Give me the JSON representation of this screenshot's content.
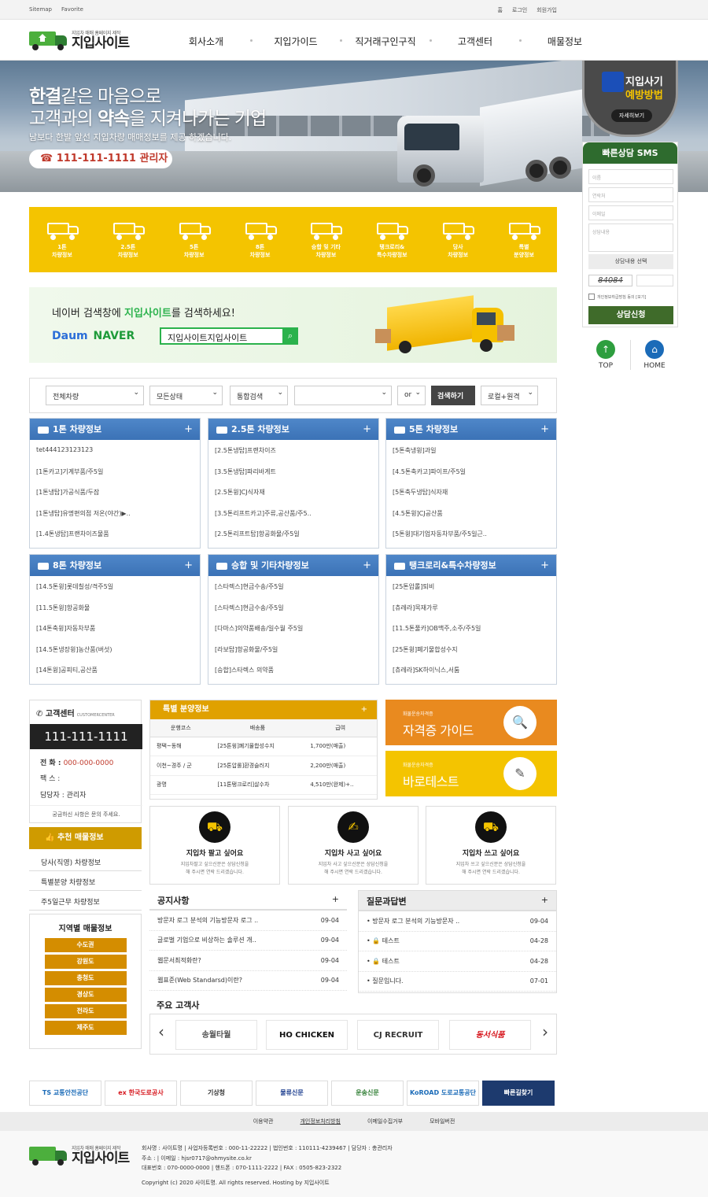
{
  "topbar": {
    "left": [
      "Sitemap",
      "Favorite"
    ],
    "right": [
      "홈",
      "로그인",
      "회원가입"
    ]
  },
  "logo": {
    "small": "지입차 매매 홈페이지 제작",
    "big": "지입사이트"
  },
  "nav": [
    "회사소개",
    "지입가이드",
    "직거래구인구직",
    "고객센터",
    "매물정보"
  ],
  "hero": {
    "line1_bold": "한결",
    "line1": "같은 마음으로",
    "line2a": "고객과의 ",
    "line2_bold": "약속",
    "line2b": "을 지켜나가는 기업",
    "sub": "남보다 한발 앞선 지입차량 매매정보를 제공 하겠습니다.",
    "phone": "☎ 111-111-1111 관리자"
  },
  "badge": {
    "t1": "지입사기",
    "t2": "예방방법",
    "btn": "자세히보기"
  },
  "sms": {
    "title": "빠른상담 SMS",
    "name": "이름",
    "phone": "연락처",
    "email": "이메일",
    "content": "상담내용",
    "select": "상담내용 선택",
    "captcha": "84084",
    "agree": "개인정보취급방침 동의 [보기]",
    "submit": "상담신청"
  },
  "quick": {
    "top": "TOP",
    "home": "HOME"
  },
  "categories": [
    {
      "l1": "1톤",
      "l2": "차량정보"
    },
    {
      "l1": "2.5톤",
      "l2": "차량정보"
    },
    {
      "l1": "5톤",
      "l2": "차량정보"
    },
    {
      "l1": "8톤",
      "l2": "차량정보"
    },
    {
      "l1": "승합 및 기타",
      "l2": "차량정보"
    },
    {
      "l1": "탱크로리&",
      "l2": "특수차량정보"
    },
    {
      "l1": "당사",
      "l2": "차량정보"
    },
    {
      "l1": "특별",
      "l2": "분양정보"
    }
  ],
  "naver": {
    "pre": "네이버 검색창에 ",
    "bold": "지입사이트",
    "post": "를 검색하세요!",
    "logo1": "Daum",
    "logo2": "NAVER",
    "query": "지입사이트지입사이트"
  },
  "search": {
    "s1": "전체차량",
    "s2": "모든상태",
    "s3": "통합검색",
    "s4": "or",
    "btn": "검색하기",
    "s5": "로컬+원격"
  },
  "panels": [
    {
      "title": "1톤 차량정보",
      "items": [
        "tet444123123123",
        "[1톤카고]기계부품/주5일",
        "[1톤냉탑]가공식품/두잠",
        "[1톤냉탑]유명편의점 저온(야간)▶..",
        "[1.4톤냉탑]프랜차이즈물품"
      ]
    },
    {
      "title": "2.5톤 차량정보",
      "items": [
        "[2.5톤냉탑]프랜차이즈",
        "[3.5톤냉탑]파리바게트",
        "[2.5톤윙]CJ식자재",
        "[3.5톤리프트카고]주류,공산품/주5..",
        "[2.5톤리프트탑]항공화물/주5일"
      ]
    },
    {
      "title": "5톤 차량정보",
      "items": [
        "[5톤축냉윙]과일",
        "[4.5톤축카고]파이프/주5일",
        "[5톤축두냉탑]식자재",
        "[4.5톤윙]CJ공산품",
        "[5톤윙]대기업자동차부품/주5일근.."
      ]
    },
    {
      "title": "8톤 차량정보",
      "items": [
        "[14.5톤윙]롯데칠성/격주5일",
        "[11.5톤윙]항공화물",
        "[14톤축윙]자동차부품",
        "[14.5톤냉장윙]농산품(버섯)",
        "[14톤윙]공피티,공산품"
      ]
    },
    {
      "title": "승합 및 기타차량정보",
      "items": [
        "[스타렉스]현금수송/주5일",
        "[스타렉스]현금수송/주5일",
        "[다마스]의약품배송/일수월 주5일",
        "[라보탑]항공화물/주5일",
        "[승합]스타렉스 의약품"
      ]
    },
    {
      "title": "탱크로리&특수차량정보",
      "items": [
        "[25톤압롤]퇴비",
        "[츄레라]목재가루",
        "[11.5톤풀카]OB맥주,소주/주5일",
        "[25톤윙]폐기물합성수지",
        "[츄레라]SK하이닉스,서툼"
      ]
    }
  ],
  "cs": {
    "title": "고객센터",
    "sub": "CUSTOMERCENTER",
    "phone": "111-111-1111",
    "tel_label": "전 화 : ",
    "tel": "000-000-0000",
    "fax": "팩 스 :",
    "manager": "담당자 : 관리자",
    "foot": "궁금하신 사항은 문의 주세요."
  },
  "rec": {
    "title": "추천 매물정보",
    "links": [
      "당사(직영) 차량정보",
      "특별분양 차량정보",
      "주5일근무 차량정보"
    ]
  },
  "region": {
    "title": "지역별 매물정보",
    "items": [
      "수도권",
      "강원도",
      "충청도",
      "경상도",
      "전라도",
      "제주도"
    ]
  },
  "special": {
    "title": "특별 분양정보",
    "cols": [
      "운행코스",
      "배송품",
      "급여"
    ],
    "rows": [
      [
        "평택~동해",
        "[25톤윙]폐기물합성수지",
        "1,700만(매출)"
      ],
      [
        "이천~경주 / 군",
        "[25톤압롤]환경슬러지",
        "2,200만(매출)"
      ],
      [
        "광명",
        "[11톤탱크로리]살수차",
        "4,510만(완제)+.."
      ]
    ]
  },
  "guide1": {
    "small": "화물운송자격증",
    "big": "자격증 가이드"
  },
  "guide2": {
    "small": "화물운송자격증",
    "big": "바로테스트"
  },
  "services": [
    {
      "t": "지입차 팔고 싶어요",
      "d1": "지입차팔고 싶으신분은 상담신청을",
      "d2": "해 주시면 연락 드리겠습니다."
    },
    {
      "t": "지입차 사고 싶어요",
      "d1": "지입차 사고 싶으신분은 상담신청을",
      "d2": "해 주시면 연락 드리겠습니다."
    },
    {
      "t": "지입차 쓰고 싶어요",
      "d1": "지입차 쓰고 싶으신분은 상담신청을",
      "d2": "해 주시면 연락 드리겠습니다."
    }
  ],
  "notice": {
    "title": "공지사항",
    "rows": [
      [
        "방문자 로그 분석의 기능방문자 로그 ..",
        "09-04"
      ],
      [
        "글로벌 기업으로 비상하는 솔루션 개..",
        "09-04"
      ],
      [
        "웹문서최적화란?",
        "09-04"
      ],
      [
        "웹표준(Web Standarsd)이란?",
        "09-04"
      ]
    ]
  },
  "qna": {
    "title": "질문과답변",
    "rows": [
      [
        "• 방문자 로그 분석의 기능방문자 ..",
        "09-04"
      ],
      [
        "• 🔒 테스트",
        "04-28"
      ],
      [
        "• 🔒 테스트",
        "04-28"
      ],
      [
        "• 질문입니다.",
        "07-01"
      ]
    ]
  },
  "clients": {
    "title": "주요 고객사",
    "items": [
      "송월타월",
      "HO CHICKEN",
      "CJ RECRUIT",
      "동서식품"
    ]
  },
  "partners": [
    "TS 교통안전공단",
    "ex 한국도로공사",
    "기상청",
    "물류신문",
    "운송신문",
    "KoROAD 도로교통공단",
    "빠른길찾기"
  ],
  "fnav": [
    "이용약관",
    "개인정보처리방침",
    "이메일수집거부",
    "모바일버전"
  ],
  "footer": {
    "l1": "회사명 : 사이트명 | 사업자등록번호 : 000-11-22222 | 법인번호 : 110111-4239467 | 담당자 : 총관리자",
    "l2": "주소 : | 이메일 : hjsr0717@ohmysite.co.kr",
    "l3": "대표번호 : 070-0000-0000 | 핸드폰 : 070-1111-2222 | FAX : 0505-823-2322",
    "l4": "Copyright (c) 2020 사이트명. All rights reserved. Hosting by 지입사이트"
  },
  "colors": {
    "yellow": "#f4c400",
    "blue": "#3b72b6",
    "green": "#3f6b2a",
    "orange": "#e67e22"
  }
}
